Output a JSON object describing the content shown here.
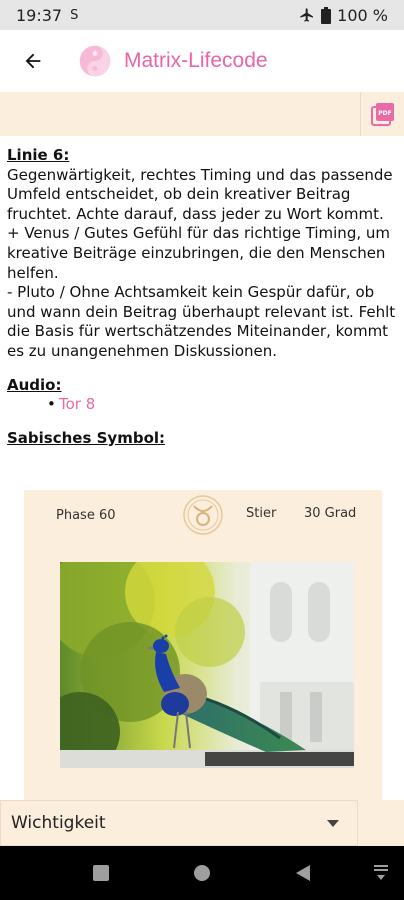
{
  "status_bar": {
    "time": "19:37",
    "sim_glyph": "S",
    "battery": "100 %",
    "icons": [
      "airplane-icon",
      "battery-icon"
    ]
  },
  "app_bar": {
    "title": "Matrix-Lifecode",
    "title_color": "#e865a8"
  },
  "toolbar": {
    "pdf_label": "PDF"
  },
  "content": {
    "line6_heading": "Linie 6:",
    "line6_text": "Gegenwärtigkeit, rechtes Timing und das passende Umfeld entscheidet, ob dein kreativer Beitrag fruchtet. Achte darauf, dass jeder zu Wort kommt.",
    "venus_text": "+ Venus / Gutes Gefühl für das richtige Timing, um kreative Beiträge einzubringen, die den Menschen helfen.",
    "pluto_text": "- Pluto / Ohne Achtsamkeit kein Gespür dafür, ob und wann dein Beitrag überhaupt relevant ist. Fehlt die Basis für wertschätzendes Miteinander, kommt es zu unangenehmen Diskussionen.",
    "audio_heading": "Audio:",
    "audio_bullet": "•",
    "audio_link": "Tor 8",
    "symbol_heading": "Sabisches Symbol:"
  },
  "sabian_card": {
    "phase": "Phase 60",
    "zodiac": "Stier",
    "degree": "30 Grad",
    "sign_icon": "taurus-icon",
    "image_subject": "peacock"
  },
  "bottom": {
    "dropdown_value": "Wichtigkeit"
  },
  "colors": {
    "accent": "#e865a8",
    "panel": "#fbeedc"
  }
}
